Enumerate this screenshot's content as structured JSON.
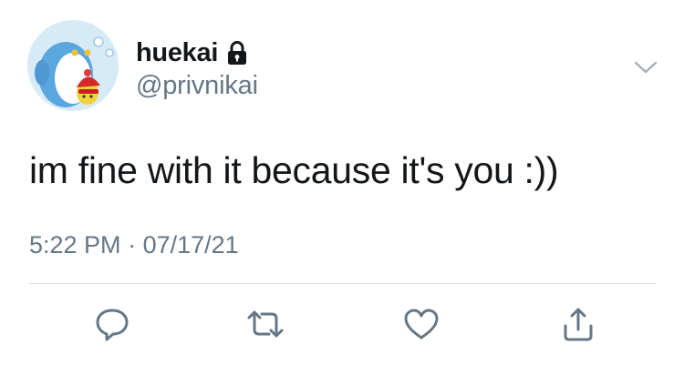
{
  "user": {
    "display_name": "huekai",
    "handle": "@privnikai",
    "protected": true
  },
  "tweet": {
    "text": "im fine with it because it's you :))",
    "time": "5:22 PM",
    "separator": "·",
    "date": "07/17/21"
  },
  "icons": {
    "lock": "lock-icon",
    "caret": "chevron-down-icon",
    "reply": "reply-icon",
    "retweet": "retweet-icon",
    "like": "heart-icon",
    "share": "share-icon"
  },
  "colors": {
    "text_primary": "#14171a",
    "text_secondary": "#657786",
    "icon": "#657786",
    "divider": "#dfe3e7",
    "avatar_bg": "#bfe0f5"
  }
}
